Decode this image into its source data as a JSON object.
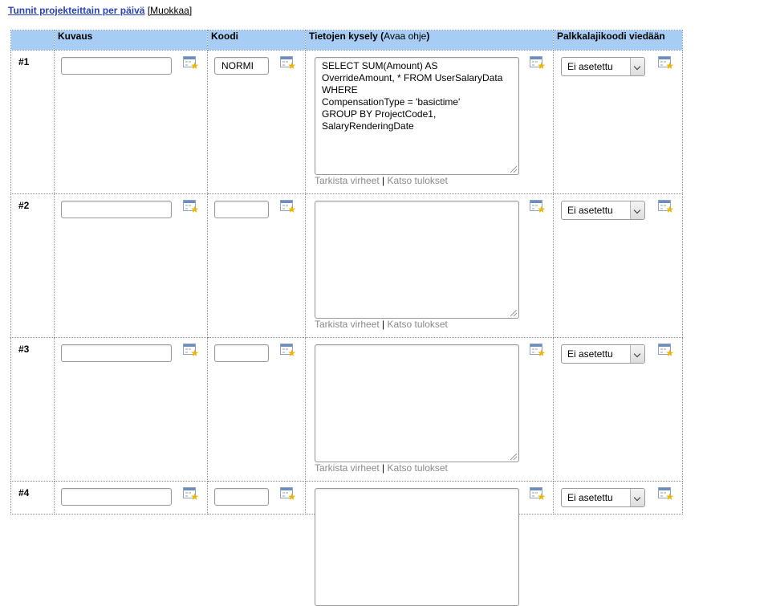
{
  "header": {
    "title_link": "Tunnit projekteittain per päivä",
    "edit_link": "[Muokkaa]"
  },
  "table": {
    "columns": {
      "num": "",
      "kuvaus": "Kuvaus",
      "koodi": "Koodi",
      "query": "Tietojen kysely (",
      "query_help": "Avaa ohje",
      "query_close": ")",
      "palkka": "Palkkalajikoodi viedään"
    },
    "rows": [
      {
        "num": "#1",
        "kuvaus": "",
        "koodi": "NORMI",
        "query": "SELECT SUM(Amount) AS\nOverrideAmount, * FROM UserSalaryData\nWHERE\nCompensationType = 'basictime'\nGROUP BY ProjectCode1,\nSalaryRenderingDate",
        "check_errors": "Tarkista virheet",
        "sep": "|",
        "view_results": "Katso tulokset",
        "palkka": "Ei asetettu"
      },
      {
        "num": "#2",
        "kuvaus": "",
        "koodi": "",
        "query": "",
        "check_errors": "Tarkista virheet",
        "sep": "|",
        "view_results": "Katso tulokset",
        "palkka": "Ei asetettu"
      },
      {
        "num": "#3",
        "kuvaus": "",
        "koodi": "",
        "query": "",
        "check_errors": "Tarkista virheet",
        "sep": "|",
        "view_results": "Katso tulokset",
        "palkka": "Ei asetettu"
      },
      {
        "num": "#4",
        "kuvaus": "",
        "koodi": "",
        "query": "",
        "palkka": "Ei asetettu"
      }
    ]
  },
  "icons": {
    "field_icon": "calendar-star-icon",
    "star": "★"
  },
  "colors": {
    "header_bg": "#a7cdf5",
    "link": "#2a43b8",
    "muted_link": "#8a8a8a"
  }
}
